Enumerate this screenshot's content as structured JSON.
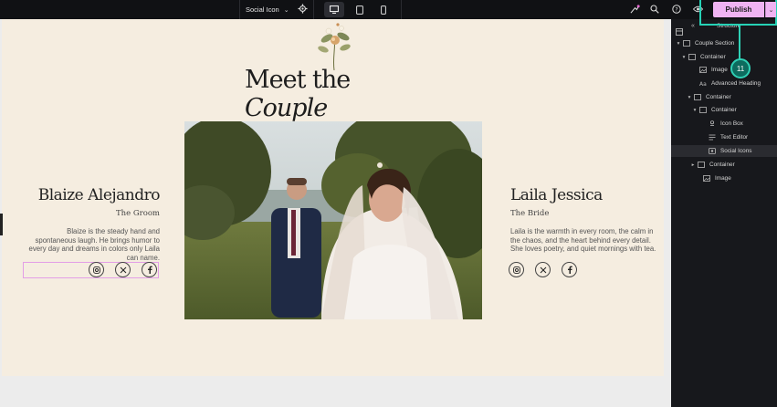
{
  "topbar": {
    "element_title": "Social Icon",
    "publish_label": "Publish",
    "icons": [
      "chevron-down-icon",
      "gear-icon",
      "desktop-icon",
      "tablet-icon",
      "mobile-icon",
      "notifications-icon",
      "search-icon",
      "help-icon",
      "preview-icon"
    ]
  },
  "page": {
    "heading_part1": "Meet the ",
    "heading_part2": "Couple",
    "groom": {
      "name": "Blaize Alejandro",
      "role": "The Groom",
      "bio": "Blaize is the steady hand and spontaneous laugh. He brings humor to every day and dreams in colors only Laila can name."
    },
    "bride": {
      "name": "Laila Jessica",
      "role": "The Bride",
      "bio": "Laila is the warmth in every room, the calm in the chaos, and the heart behind every detail. She loves poetry, and quiet mornings with tea."
    },
    "social_icons": [
      "instagram-icon",
      "x-icon",
      "facebook-icon"
    ]
  },
  "structure": {
    "title": "Structure",
    "items": [
      {
        "label": "Couple Section",
        "arrow": "▾",
        "icon": "section"
      },
      {
        "label": "Container",
        "arrow": "▾",
        "icon": "container"
      },
      {
        "label": "Image",
        "arrow": "",
        "icon": "image"
      },
      {
        "label": "Advanced Heading",
        "arrow": "",
        "icon": "heading"
      },
      {
        "label": "Container",
        "arrow": "▾",
        "icon": "container"
      },
      {
        "label": "Container",
        "arrow": "▾",
        "icon": "container"
      },
      {
        "label": "Icon Box",
        "arrow": "",
        "icon": "iconbox"
      },
      {
        "label": "Text Editor",
        "arrow": "",
        "icon": "text"
      },
      {
        "label": "Social Icons",
        "arrow": "",
        "icon": "social"
      },
      {
        "label": "Container",
        "arrow": "▸",
        "icon": "container"
      },
      {
        "label": "Image",
        "arrow": "",
        "icon": "image"
      }
    ]
  },
  "step_badge": "11",
  "colors": {
    "accent_teal": "#2fd0b5",
    "publish_pink": "#f0b3f2",
    "section_bg": "#f5ede0",
    "sidebar_bg": "#17181c"
  }
}
